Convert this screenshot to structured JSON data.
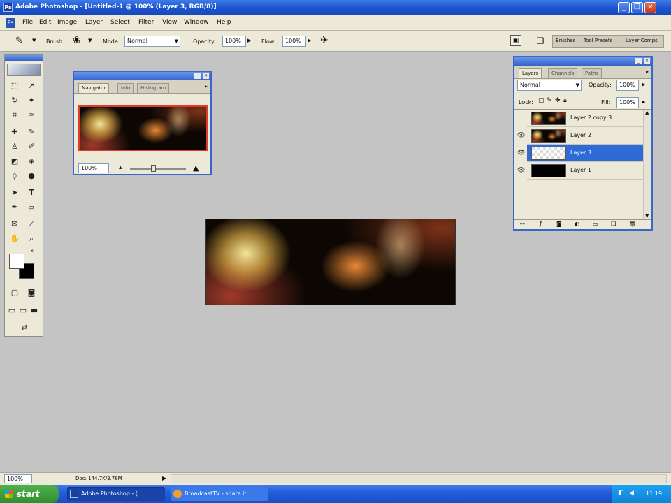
{
  "window": {
    "title": "Adobe Photoshop - [Untitled-1 @ 100% (Layer 3, RGB/8)]"
  },
  "menu": [
    "File",
    "Edit",
    "Image",
    "Layer",
    "Select",
    "Filter",
    "View",
    "Window",
    "Help"
  ],
  "options": {
    "brush_label": "Brush:",
    "mode_label": "Mode:",
    "mode_value": "Normal",
    "opacity_label": "Opacity:",
    "opacity_value": "100%",
    "flow_label": "Flow:",
    "flow_value": "100%",
    "well_tabs": [
      "Brushes",
      "Tool Presets",
      "Layer Comps"
    ]
  },
  "navigator": {
    "tabs": [
      "Navigator",
      "Info",
      "Histogram"
    ],
    "zoom": "100%"
  },
  "layers_panel": {
    "tabs": [
      "Layers",
      "Channels",
      "Paths"
    ],
    "blend_mode": "Normal",
    "opacity_label": "Opacity:",
    "opacity_value": "100%",
    "lock_label": "Lock:",
    "fill_label": "Fill:",
    "fill_value": "100%",
    "layers": [
      {
        "name": "Layer 2 copy 3",
        "selected": false
      },
      {
        "name": "Layer 2",
        "selected": false
      },
      {
        "name": "Layer 3",
        "selected": true
      },
      {
        "name": "Layer 1",
        "selected": false
      }
    ]
  },
  "status": {
    "zoom": "100%",
    "doc": "Doc: 144.7K/3.78M"
  },
  "taskbar": {
    "start": "start",
    "tasks": [
      "Adobe Photoshop - [...",
      "BroadcastTV - share it..."
    ],
    "clock": "11:19"
  }
}
